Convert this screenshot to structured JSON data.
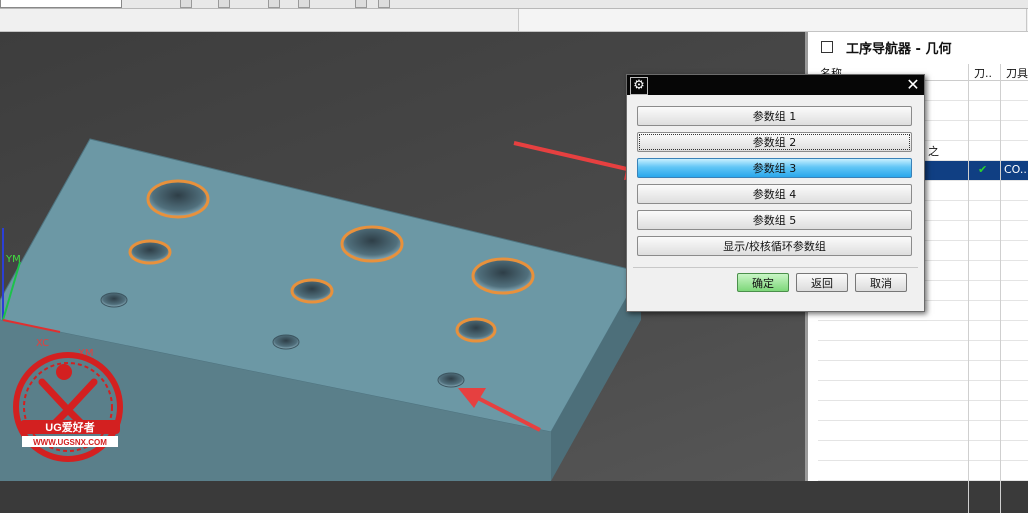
{
  "navigator": {
    "title": "工序导航器 - 几何",
    "columns": [
      "名称",
      "刀..",
      "刀具"
    ],
    "selected_row": {
      "check": "✔",
      "tool": "CO.."
    },
    "partial_label": "之"
  },
  "dialog": {
    "gear": "⚙",
    "close": "✕",
    "groups": [
      "参数组 1",
      "参数组 2",
      "参数组 3",
      "参数组 4",
      "参数组 5",
      "显示/校核循环参数组"
    ],
    "active_index": 2,
    "ok": "确定",
    "back": "返回",
    "cancel": "取消"
  },
  "axis_labels": {
    "ym": "YM",
    "xc": "XC",
    "xm": "XM"
  },
  "watermark": {
    "brand": "UG爱好者",
    "url": "WWW.UGSNX.COM"
  },
  "colors": {
    "part": "#6c98a5",
    "hole_outline": "#e8913c",
    "selection": "#103f83",
    "arrow": "#e64040"
  }
}
